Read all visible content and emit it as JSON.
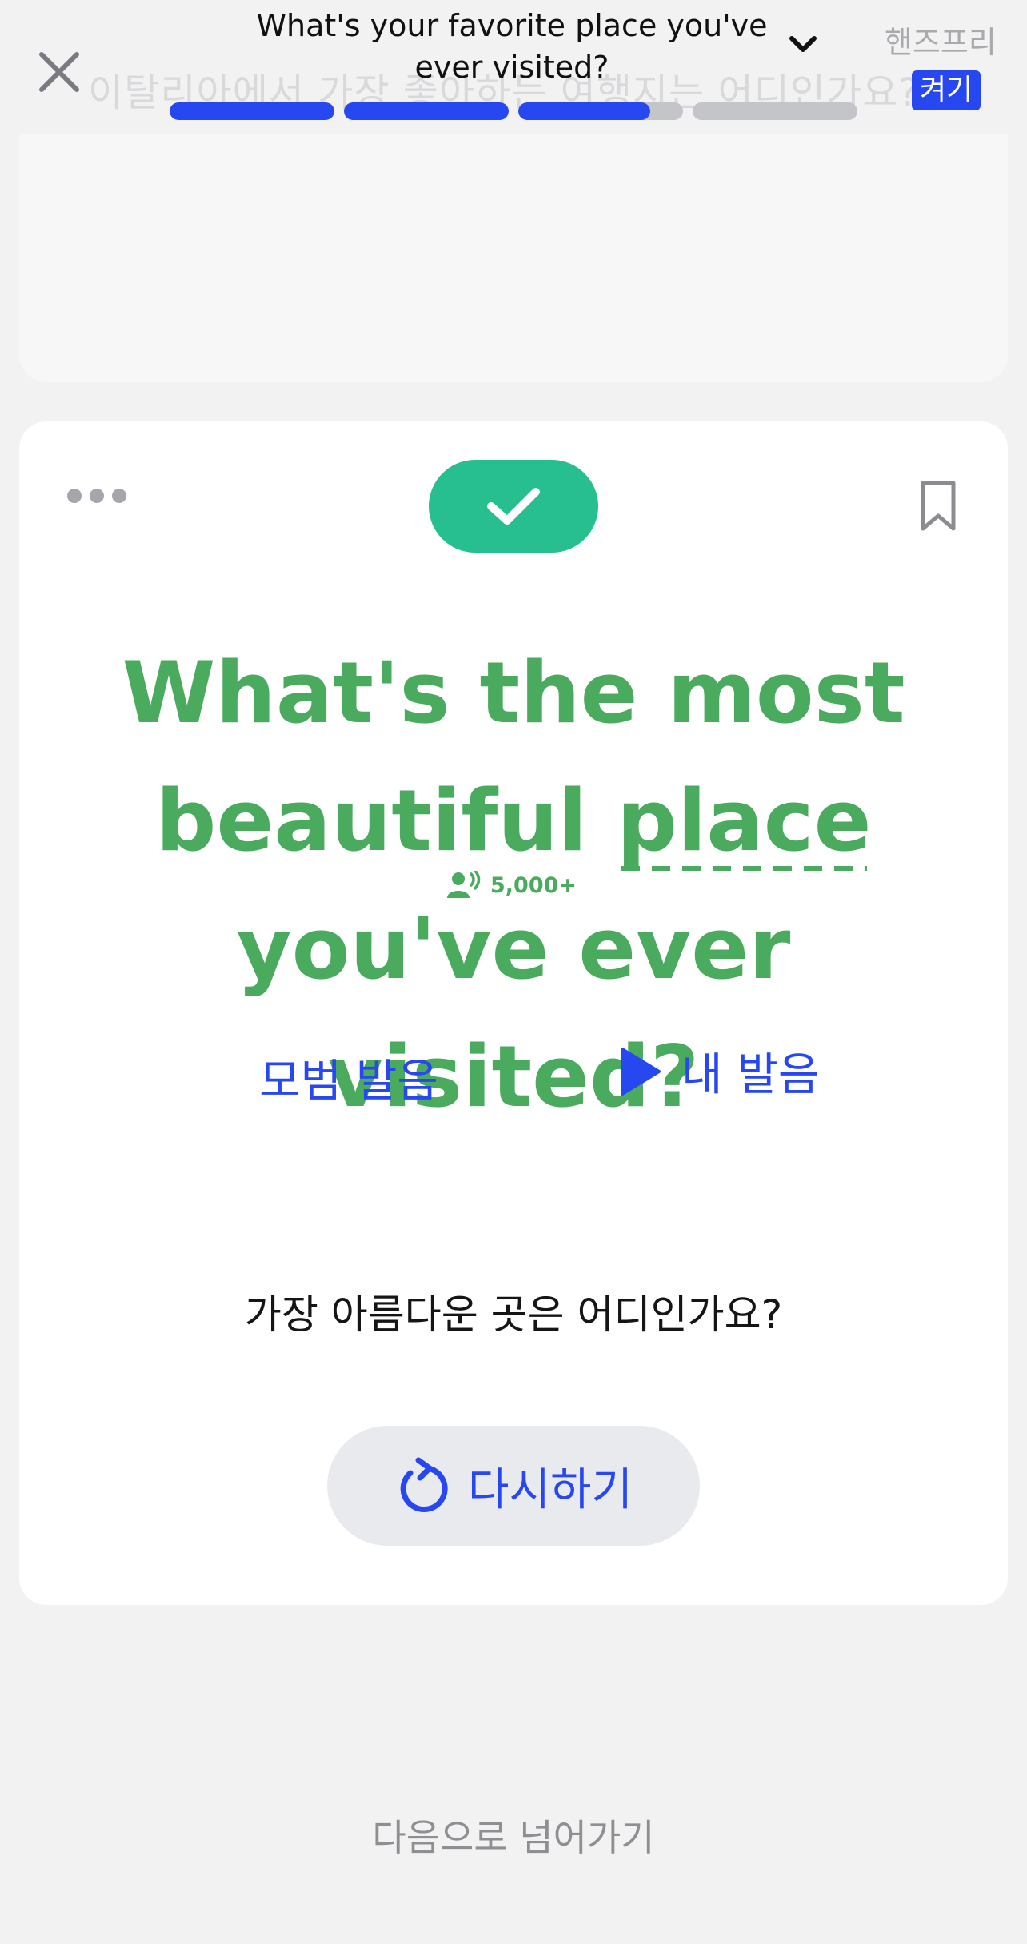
{
  "header": {
    "title": "What's your favorite place you've ever visited?",
    "background_text": "이탈리아에서 가장 좋아하는 여행지는 어디인가요?",
    "handsfree": {
      "label": "핸즈프리",
      "toggle": "켜기"
    },
    "progress": [
      1,
      1,
      0.8,
      0
    ]
  },
  "card": {
    "status": "correct",
    "sentence": {
      "before": "What's the most beautiful ",
      "highlight": "place",
      "after": " you've ever visited?"
    },
    "listen_count": "5,000+",
    "model_pronunciation": "모범 발음",
    "my_pronunciation": "내 발음",
    "translation": "가장 아름다운 곳은 어디인가요?",
    "retry_label": "다시하기"
  },
  "footer": {
    "next_label": "다음으로 넘어가기"
  },
  "colors": {
    "accent": "#2747f1",
    "success": "#27bf8f",
    "sentence": "#4aab5e"
  }
}
